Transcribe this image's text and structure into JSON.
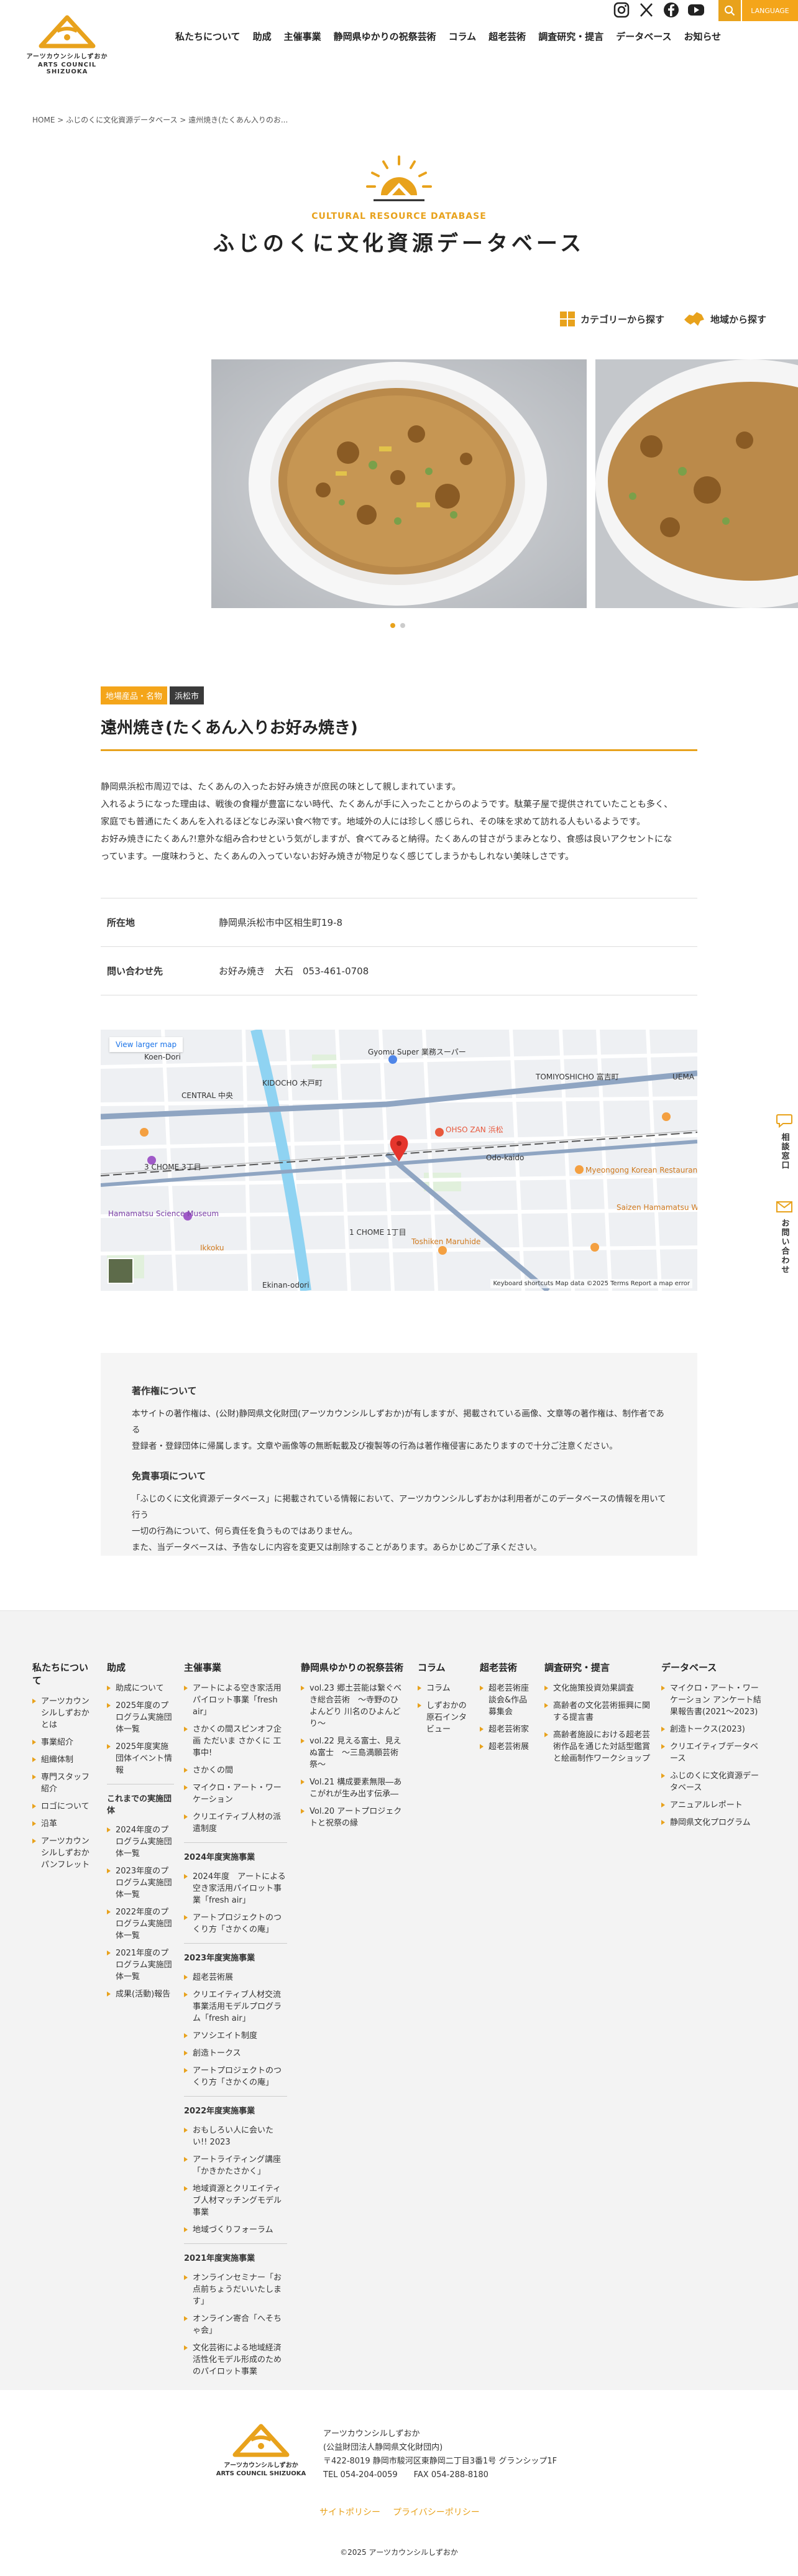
{
  "header": {
    "logo_jp": "アーツカウンシルしずおか",
    "logo_en": "ARTS COUNCIL SHIZUOKA",
    "nav": [
      "私たちについて",
      "助成",
      "主催事業",
      "静岡県ゆかりの祝祭芸術",
      "コラム",
      "超老芸術",
      "調査研究・提言",
      "データベース",
      "お知らせ"
    ],
    "language": "LANGUAGE"
  },
  "breadcrumb": "HOME > ふじのくに文化資源データベース > 遠州焼き(たくあん入りのお...",
  "db": {
    "en": "CULTURAL RESOURCE DATABASE",
    "title": "ふじのくに文化資源データベース",
    "by_category": "カテゴリーから探す",
    "by_region": "地域から探す"
  },
  "item": {
    "tags": [
      "地場産品・名物",
      "浜松市"
    ],
    "title": "遠州焼き(たくあん入りお好み焼き)",
    "desc": [
      "静岡県浜松市周辺では、たくあんの入ったお好み焼きが庶民の味として親しまれています。",
      "入れるようになった理由は、戦後の食糧が豊富にない時代、たくあんが手に入ったことからのようです。駄菓子屋で提供されていたことも多く、",
      "家庭でも普通にたくあんを入れるほどなじみ深い食べ物です。地域外の人には珍しく感じられ、その味を求めて訪れる人もいるようです。",
      "お好み焼きにたくあん?!意外な組み合わせという気がしますが、食べてみると納得。たくあんの甘さがうまみとなり、食感は良いアクセントにな",
      "っています。一度味わうと、たくあんの入っていないお好み焼きが物足りなく感じてしまうかもしれない美味しさです。"
    ],
    "location_label": "所在地",
    "location": "静岡県浜松市中区相生町19-8",
    "contact_label": "問い合わせ先",
    "contact": "お好み焼き　大石　053-461-0708"
  },
  "map": {
    "larger": "View larger map",
    "labels": [
      "Koen-Dori",
      "KIDOCHO 木戸町",
      "CENTRAL 中央",
      "TOMIYOSHICHO 富吉町",
      "Gyomu Super 業務スーパー",
      "OHSO ZAN 浜松",
      "Myeongong Korean Restaurant",
      "Hamamatsu Science Museum",
      "Toshiken Maruhide",
      "Ekinan-odori",
      "UEMA",
      "3 CHOME 3丁目",
      "1 CHOME 1丁目",
      "Ikkoku",
      "Saizen Hamamatsu Waka",
      "Odo-kaido"
    ],
    "attrib": "Keyboard shortcuts   Map data ©2025   Terms   Report a map error"
  },
  "notice": {
    "copyright_title": "著作権について",
    "copyright_text": [
      "本サイトの著作権は、(公財)静岡県文化財団(アーツカウンシルしずおか)が有しますが、掲載されている画像、文章等の著作権は、制作者である",
      "登録者・登録団体に帰属します。文章や画像等の無断転載及び複製等の行為は著作権侵害にあたりますので十分ご注意ください。"
    ],
    "disclaimer_title": "免責事項について",
    "disclaimer_text": [
      "「ふじのくに文化資源データベース」に掲載されている情報において、アーツカウンシルしずおかは利用者がこのデータベースの情報を用いて行う",
      "一切の行為について、何ら責任を負うものではありません。",
      "また、当データベースは、予告なしに内容を変更又は削除することがあります。あらかじめご了承ください。"
    ]
  },
  "sidetabs": {
    "consult": "相談窓口",
    "contact": "お問い合わせ"
  },
  "footer_nav": {
    "about": {
      "title": "私たちについて",
      "items": [
        "アーツカウンシルしずおかとは",
        "事業紹介",
        "組織体制",
        "専門スタッフ紹介",
        "ロゴについて",
        "沿革",
        "アーツカウンシルしずおかパンフレット"
      ]
    },
    "grant": {
      "title": "助成",
      "items": [
        "助成について",
        "2025年度のプログラム実施団体一覧",
        "2025年度実施団体イベント情報"
      ],
      "sub": "これまでの実施団体",
      "items2": [
        "2024年度のプログラム実施団体一覧",
        "2023年度のプログラム実施団体一覧",
        "2022年度のプログラム実施団体一覧",
        "2021年度のプログラム実施団体一覧",
        "成果(活動)報告"
      ]
    },
    "project": {
      "title": "主催事業",
      "items": [
        "アートによる空き家活用パイロット事業「fresh air」",
        "さかくの間スピンオフ企画 ただいま さかくに 工事中!",
        "さかくの間",
        "マイクロ・アート・ワーケーション",
        "クリエイティブ人材の派遣制度"
      ],
      "groups": [
        {
          "sub": "2024年度実施事業",
          "items": [
            "2024年度　アートによる空き家活用パイロット事業「fresh air」",
            "アートプロジェクトのつくり方「さかくの庵」"
          ]
        },
        {
          "sub": "2023年度実施事業",
          "items": [
            "超老芸術展",
            "クリエイティブ人材交流事業活用モデルプログラム「fresh air」",
            "アソシエイト制度",
            "創造トークス",
            "アートプロジェクトのつくり方「さかくの庵」"
          ]
        },
        {
          "sub": "2022年度実施事業",
          "items": [
            "おもしろい人に会いたい!! 2023",
            "アートライティング講座「かきかたさかく」",
            "地域資源とクリエイティブ人材マッチングモデル事業",
            "地域づくりフォーラム"
          ]
        },
        {
          "sub": "2021年度実施事業",
          "items": [
            "オンラインセミナー「お点前ちょうだいいたします」",
            "オンライン寄合「へそちゃ会」",
            "文化芸術による地域経済活性化モデル形成のためのパイロット事業"
          ]
        }
      ]
    },
    "festival": {
      "title": "静岡県ゆかりの祝祭芸術",
      "items": [
        "vol.23 郷土芸能は繋ぐべき総合芸術　〜寺野のひよんどり 川名のひよんどり〜",
        "vol.22 見える富士、見えぬ富士　〜三島満願芸術祭〜",
        "Vol.21 構成要素無限―あこがれが生み出す伝承―",
        "Vol.20 アートプロジェクトと祝祭の縁"
      ]
    },
    "column": {
      "title": "コラム",
      "items": [
        "コラム",
        "しずおかの原石インタビュー"
      ]
    },
    "elder": {
      "title": "超老芸術",
      "items": [
        "超老芸術座談会&作品募集会",
        "超老芸術家",
        "超老芸術展"
      ]
    },
    "research": {
      "title": "調査研究・提言",
      "items": [
        "文化施策投資効果調査",
        "高齢者の文化芸術振興に関する提言書",
        "高齢者施設における超老芸術作品を通じた対話型鑑賞と絵画制作ワークショップ"
      ]
    },
    "database": {
      "title": "データベース",
      "items": [
        "マイクロ・アート・ワーケーション アンケート結果報告書(2021〜2023)",
        "創造トークス(2023)",
        "クリエイティブデータベース",
        "ふじのくに文化資源データベース",
        "アニュアルレポート",
        "静岡県文化プログラム"
      ]
    }
  },
  "footer": {
    "org": "アーツカウンシルしずおか",
    "org2": "(公益財団法人静岡県文化財団内)",
    "addr": "〒422-8019 静岡市駿河区東静岡二丁目3番1号 グランシップ1F",
    "tel": "TEL 054-204-0059　　FAX 054-288-8180",
    "sitepolicy": "サイトポリシー",
    "privacy": "プライバシーポリシー",
    "copyright": "©2025 アーツカウンシルしずおか"
  },
  "colors": {
    "accent": "#e8a21c",
    "dark_tag": "#3a3a3a",
    "footer_bg": "#f3f3f3"
  }
}
